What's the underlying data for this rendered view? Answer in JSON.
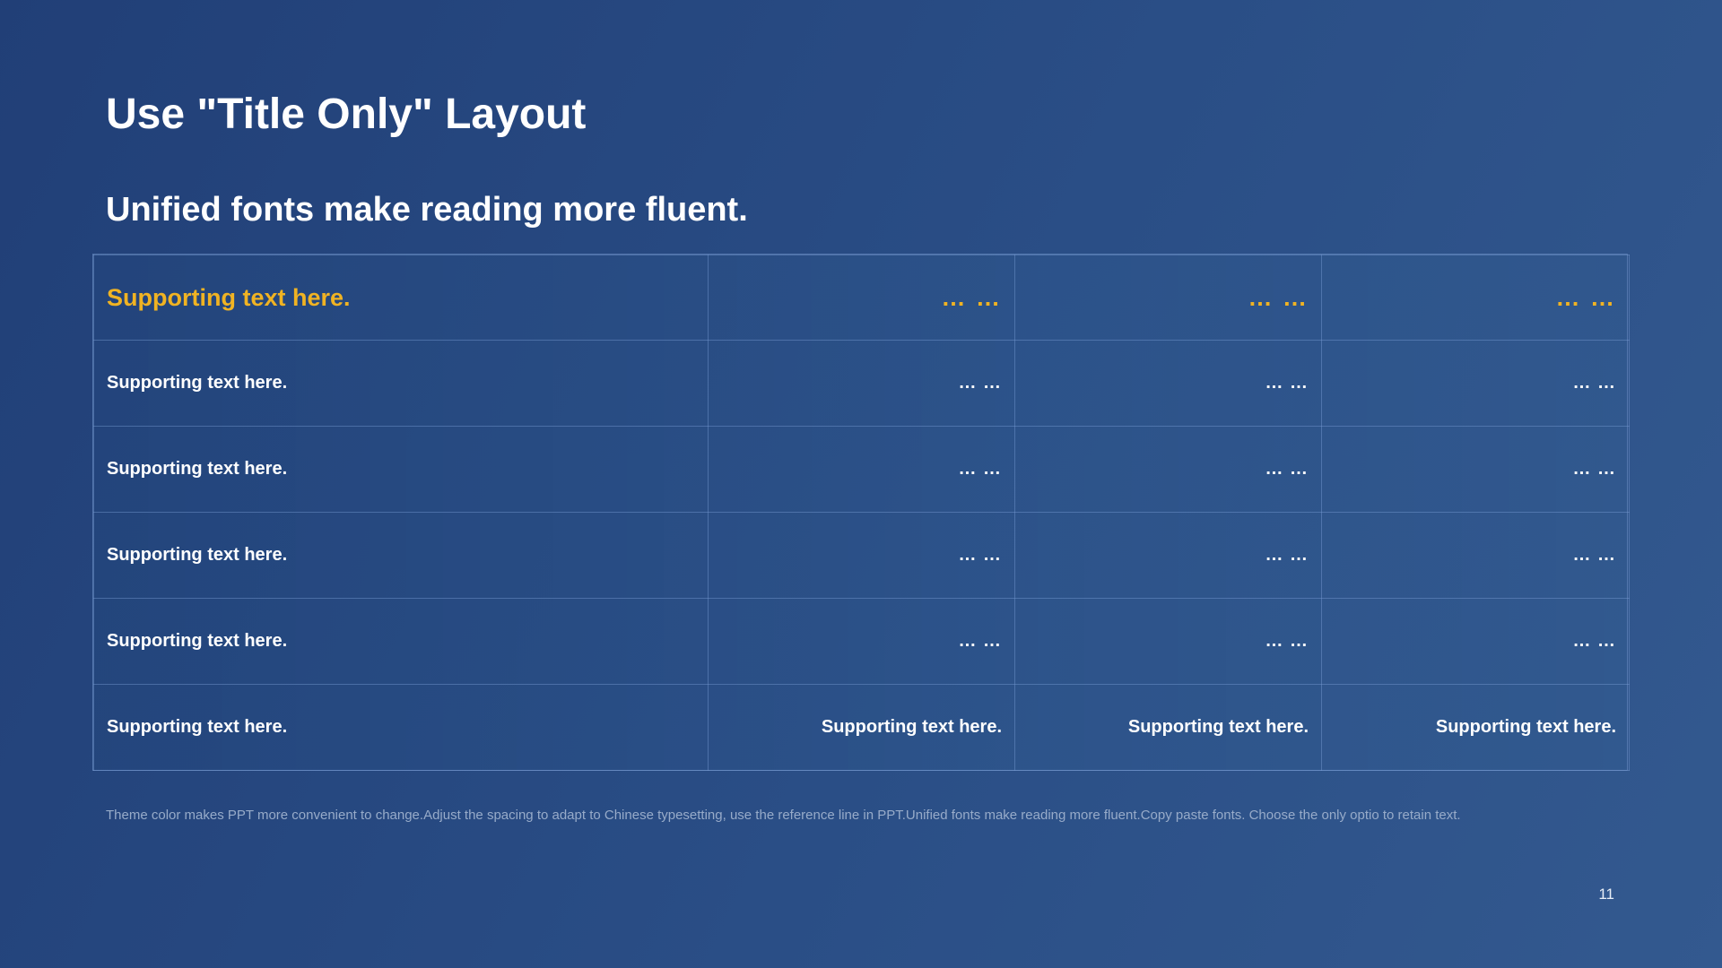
{
  "slide": {
    "title": "Use \"Title Only\" Layout",
    "subtitle": "Unified fonts make reading more fluent.",
    "footnote": "Theme  color makes PPT more convenient  to change.Adjust  the spacing to adapt to Chinese typesetting,  use the reference line  in PPT.Unified fonts make reading more fluent.Copy  paste fonts.  Choose the only optio to retain text.",
    "page_number": "11"
  },
  "colors": {
    "accent": "#f0b323",
    "text": "#ffffff",
    "background": "#233f74"
  },
  "table": {
    "header": [
      "Supporting text here.",
      "… …",
      "… …",
      "… …"
    ],
    "rows": [
      [
        "Supporting text here.",
        "… …",
        "… …",
        "… …"
      ],
      [
        "Supporting text here.",
        "… …",
        "… …",
        "… …"
      ],
      [
        "Supporting text here.",
        "… …",
        "… …",
        "… …"
      ],
      [
        "Supporting text here.",
        "… …",
        "… …",
        "… …"
      ],
      [
        "Supporting text here.",
        "Supporting text here.",
        "Supporting text here.",
        "Supporting text here."
      ]
    ]
  }
}
